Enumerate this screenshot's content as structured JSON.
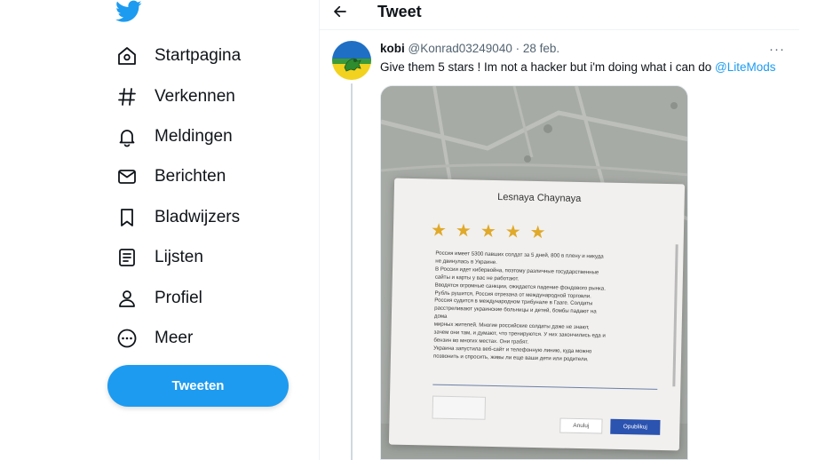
{
  "nav": {
    "items": [
      {
        "label": "Startpagina",
        "icon": "home-icon"
      },
      {
        "label": "Verkennen",
        "icon": "hashtag-icon"
      },
      {
        "label": "Meldingen",
        "icon": "bell-icon"
      },
      {
        "label": "Berichten",
        "icon": "mail-icon"
      },
      {
        "label": "Bladwijzers",
        "icon": "bookmark-icon"
      },
      {
        "label": "Lijsten",
        "icon": "list-icon"
      },
      {
        "label": "Profiel",
        "icon": "person-icon"
      },
      {
        "label": "Meer",
        "icon": "more-circle-icon"
      }
    ],
    "tweet_button": "Tweeten"
  },
  "header": {
    "title": "Tweet"
  },
  "tweet": {
    "display_name": "kobi",
    "handle": "@Konrad03249040",
    "separator": "·",
    "date": "28 feb.",
    "text": "Give them 5 stars ! Im not a hacker but i'm doing what i can do ",
    "mention": "@LiteMods",
    "more_label": "···"
  },
  "photo": {
    "dialog_title": "Lesnaya Chaynaya",
    "stars": "★★★★★",
    "rating": 5,
    "review_lines": [
      "Россия имеет 5300 павших солдат за 5 дней, 800 в плену и никуда",
      "не двинулась в Украине.",
      "В России идет кибервойна, поэтому различные государственные",
      "сайты и карты у вас не работают.",
      "Вводятся огромные санкции, ожидается падение фондового рынка.",
      "Рубль рушится, Россия отрезана от международной торговли.",
      "Россия судится в международном трибунале в Гааге. Солдаты",
      "расстреливают украинские больницы и детей, бомбы падают на",
      "дома",
      "мирных жителей. Многие российские солдаты даже не знают,",
      "зачем они там, и думают, что тренируются. У них закончились еда и",
      "бензин во многих местах. Они грабят.",
      "Украина запустила веб-сайт и телефонную линию, куда можно",
      "позвонить и спросить, живы ли еще ваши дети или родители."
    ],
    "cancel_label": "Anuluj",
    "publish_label": "Opublikuj"
  },
  "colors": {
    "accent": "#1d9bf0",
    "star": "#e0a92a",
    "publish": "#2b53b0"
  }
}
